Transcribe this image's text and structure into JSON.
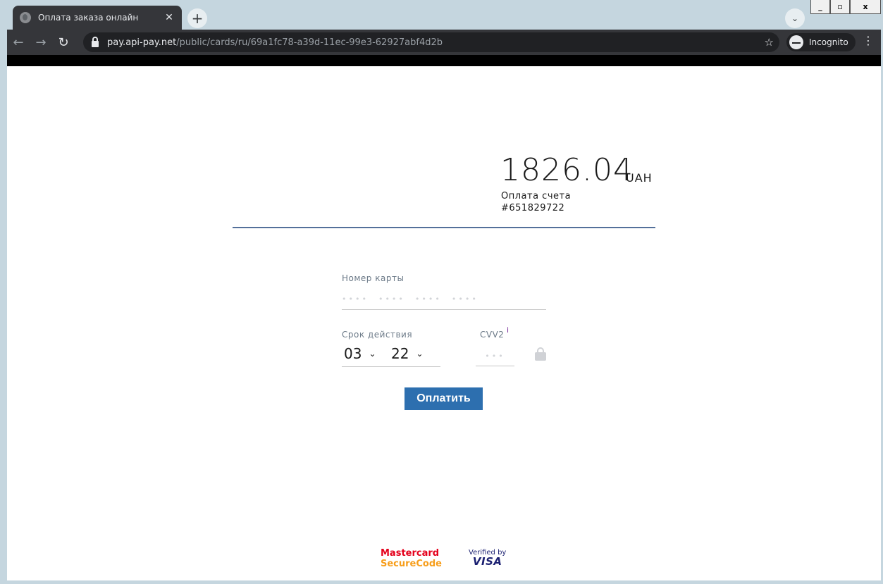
{
  "browser": {
    "tab_title": "Оплата заказа онлайн",
    "tab_close": "✕",
    "new_tab": "+",
    "tab_search": "⌄",
    "url_host": "pay.api-pay.net",
    "url_path": "/public/cards/ru/69a1fc78-a39d-11ec-99e3-62927abf4d2b",
    "incognito_label": "Incognito",
    "back": "←",
    "forward": "→",
    "reload": "↻",
    "star": "☆",
    "menu": "⋮",
    "window": {
      "minimize": "_",
      "maximize": "▫",
      "close": "x"
    }
  },
  "payment": {
    "amount": "1826.04",
    "currency": "UAH",
    "invoice_label": "Оплата счета",
    "invoice_number": "#651829722"
  },
  "form": {
    "card_number_label": "Номер карты",
    "card_number_placeholder": [
      "••••",
      "••••",
      "••••",
      "••••"
    ],
    "expiry_label": "Срок действия",
    "expiry_month": "03",
    "expiry_year": "22",
    "cvv_label": "CVV2",
    "cvv_info": "i",
    "cvv_placeholder": "•••",
    "pay_button": "Оплатить"
  },
  "footer": {
    "mastercard_line1": "Mastercard",
    "mastercard_line2": "SecureCode",
    "visa_line1": "Verified by",
    "visa_line2": "VISA"
  }
}
